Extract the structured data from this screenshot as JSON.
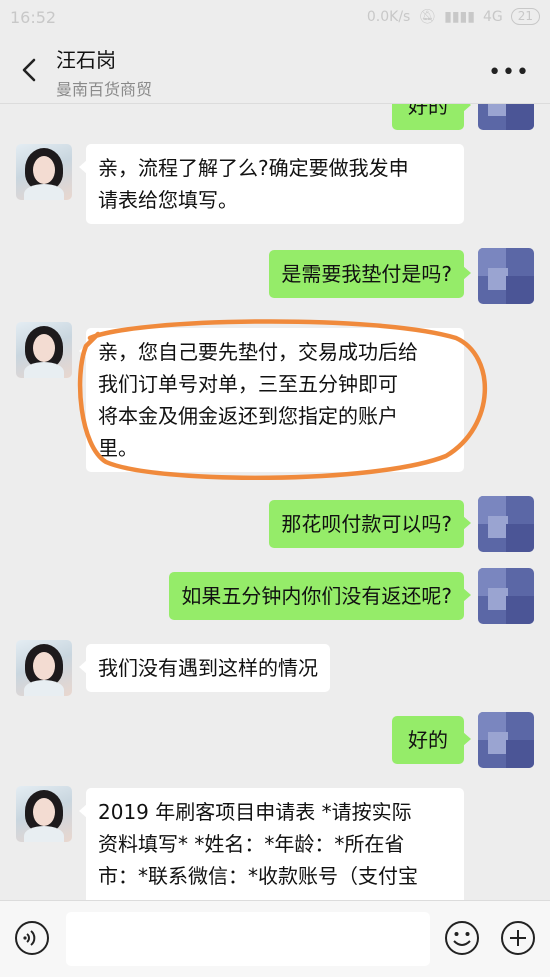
{
  "status_bar": {
    "time": "16:52",
    "network_speed": "0.0K/s",
    "signal": "4G",
    "battery": "21"
  },
  "header": {
    "title": "汪石岗",
    "subtitle": "曼南百货商贸"
  },
  "messages": [
    {
      "from": "me",
      "text": "好的"
    },
    {
      "from": "them",
      "lines": [
        "亲，流程了解了么?确定要做我发申",
        "请表给您填写。"
      ]
    },
    {
      "from": "me",
      "text": "是需要我垫付是吗?"
    },
    {
      "from": "them",
      "lines": [
        "亲，您自己要先垫付，交易成功后给",
        "我们订单号对单，三至五分钟即可",
        "将本金及佣金返还到您指定的账户",
        "里。"
      ]
    },
    {
      "from": "me",
      "text": "那花呗付款可以吗?"
    },
    {
      "from": "me",
      "text": "如果五分钟内你们没有返还呢?"
    },
    {
      "from": "them",
      "lines": [
        "我们没有遇到这样的情况"
      ]
    },
    {
      "from": "me",
      "text": "好的"
    },
    {
      "from": "them",
      "lines": [
        "2019 年刷客项目申请表 *请按实际",
        "资料填写* *姓名：*年龄：*所在省",
        "市：*联系微信：*收款账号（支付宝"
      ]
    }
  ],
  "input_bar": {
    "placeholder": ""
  },
  "colors": {
    "my_bubble": "#95ec69",
    "their_bubble": "#ffffff",
    "annotation_circle": "#f08a3c",
    "background": "#ededed"
  }
}
